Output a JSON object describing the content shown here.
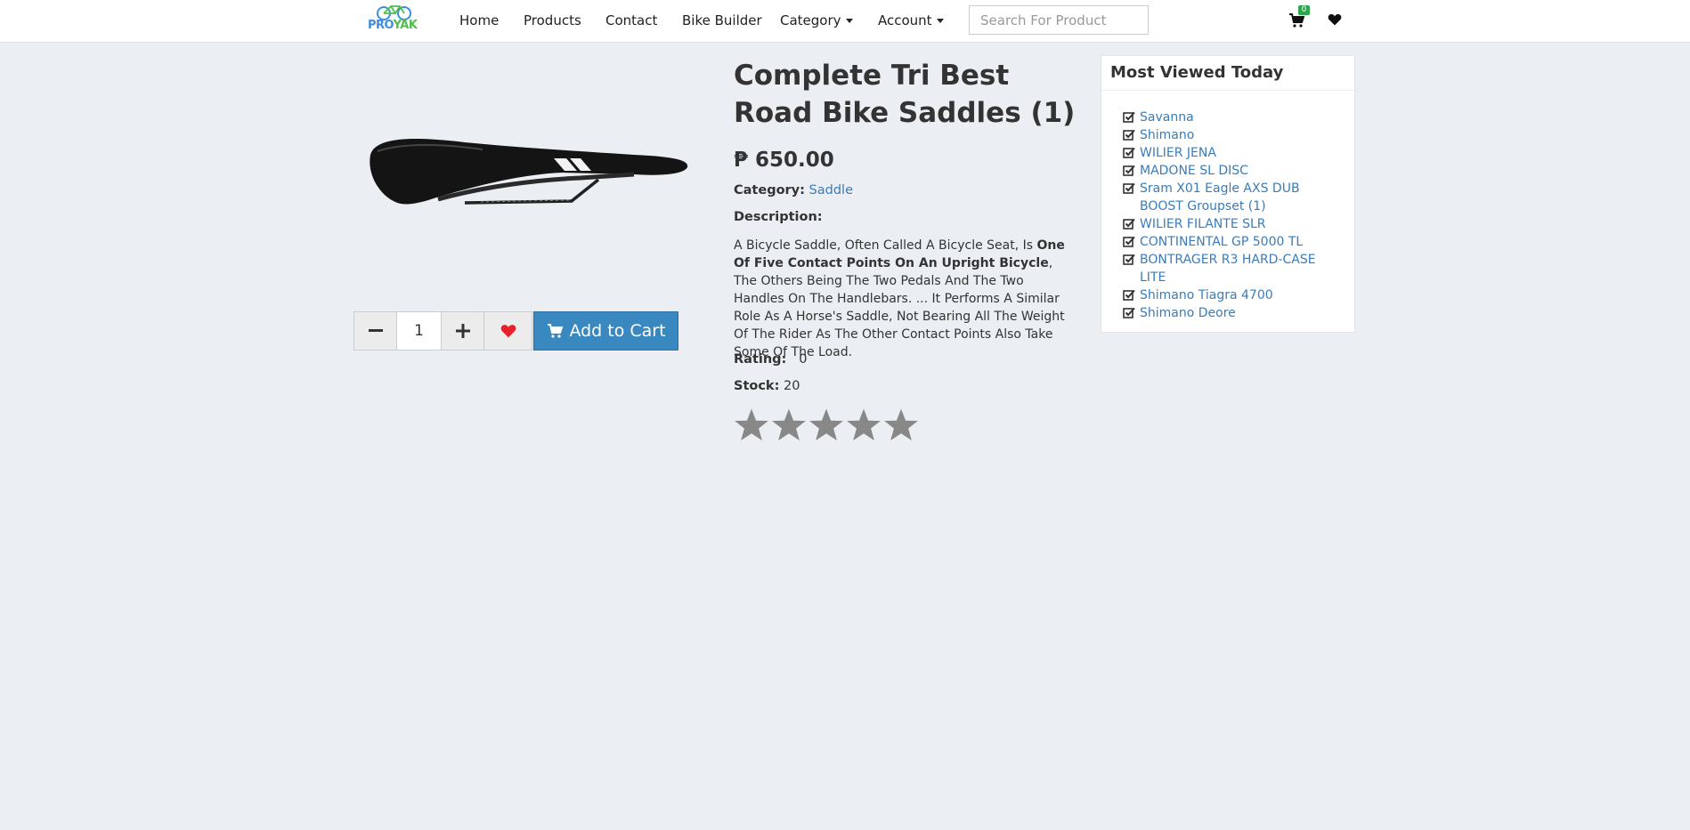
{
  "nav": {
    "logo_text_a": "PRO",
    "logo_text_b": "YAK",
    "links": [
      "Home",
      "Products",
      "Contact",
      "Bike Builder",
      "Category",
      "Account"
    ],
    "search_placeholder": "Search For Product",
    "cart_count": "0",
    "icons": [
      "cart-icon",
      "heart-icon"
    ]
  },
  "product": {
    "title": "Complete Tri Best Road Bike Saddles (1)",
    "price": "₱ 650.00",
    "category_label": "Category:",
    "category_value": "Saddle",
    "description_label": "Description:",
    "description_1": "A Bicycle Saddle, Often Called A Bicycle Seat, Is ",
    "description_bold": "One Of Five Contact Points On An Upright Bicycle",
    "description_2": ", The Others Being The Two Pedals And The Two Handles On The Handlebars. ... It Performs A Similar Role As A Horse's Saddle, Not Bearing All The Weight Of The Rider As The Other Contact Points Also Take Some Of The Load.",
    "rating_label": "Rating:",
    "rating_value": "0",
    "stock_label": "Stock:",
    "stock_value": "20",
    "stars_filled": 0,
    "stars_total": 5
  },
  "purchase": {
    "quantity": "1",
    "add_to_cart_label": "Add to Cart"
  },
  "sidebar": {
    "title": "Most Viewed Today",
    "items": [
      "Savanna",
      "Shimano",
      "WILIER JENA",
      "MADONE SL DISC",
      "Sram X01 Eagle AXS DUB BOOST Groupset (1)",
      "WILIER FILANTE SLR",
      "CONTINENTAL GP 5000 TL",
      "BONTRAGER R3 HARD-CASE LITE",
      "Shimano Tiagra 4700",
      "Shimano Deore"
    ]
  },
  "colors": {
    "background": "#ebeef3",
    "link": "#3b7cb8",
    "button": "#3a88c0",
    "heart": "#e8202a",
    "star": "#888888",
    "badge": "#2aa84a"
  }
}
